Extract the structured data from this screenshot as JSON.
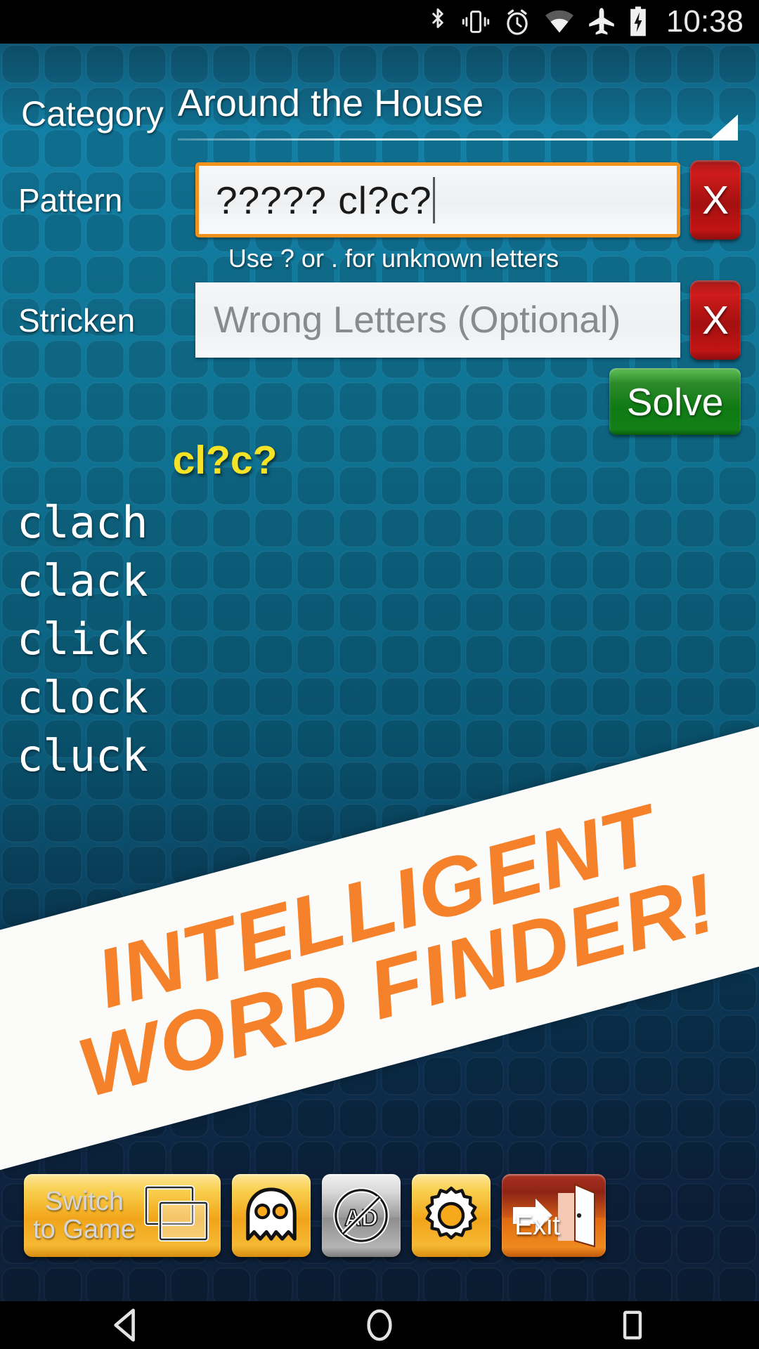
{
  "status_bar": {
    "icons": [
      "bluetooth-icon",
      "vibrate-icon",
      "alarm-icon",
      "wifi-icon",
      "airplane-mode-icon",
      "battery-charging-icon"
    ],
    "time": "10:38"
  },
  "form": {
    "category_label": "Category",
    "category_value": "Around the House",
    "pattern_label": "Pattern",
    "pattern_value": "????? cl?c?",
    "pattern_hint": "Use ? or . for unknown letters",
    "clear_pattern_label": "X",
    "stricken_label": "Stricken",
    "stricken_value": "",
    "stricken_placeholder": "Wrong Letters (Optional)",
    "clear_stricken_label": "X",
    "solve_label": "Solve"
  },
  "results": {
    "pattern_heading": "cl?c?",
    "words": [
      "clach",
      "clack",
      "click",
      "clock",
      "cluck"
    ]
  },
  "banner": {
    "line1": "INTELLIGENT",
    "line2": "WORD FINDER!",
    "text_color": "#f5822a",
    "background_color": "#fbfbf9"
  },
  "toolbar": {
    "switch_label": "Switch to Game",
    "switch_icon": "windows-stack-icon",
    "ghost_icon": "ghost-icon",
    "no_ads_icon": "no-ads-icon",
    "settings_icon": "gear-icon",
    "exit_label": "Exit",
    "exit_icon": "exit-door-icon"
  },
  "navbar": {
    "back": "back-triangle-icon",
    "home": "home-circle-icon",
    "recents": "recents-square-icon"
  },
  "colors": {
    "accent_orange": "#f2921d",
    "solve_green": "#0f7a14",
    "clear_red": "#c21414",
    "heading_yellow": "#f5e327",
    "background_teal": "#0f7494"
  }
}
